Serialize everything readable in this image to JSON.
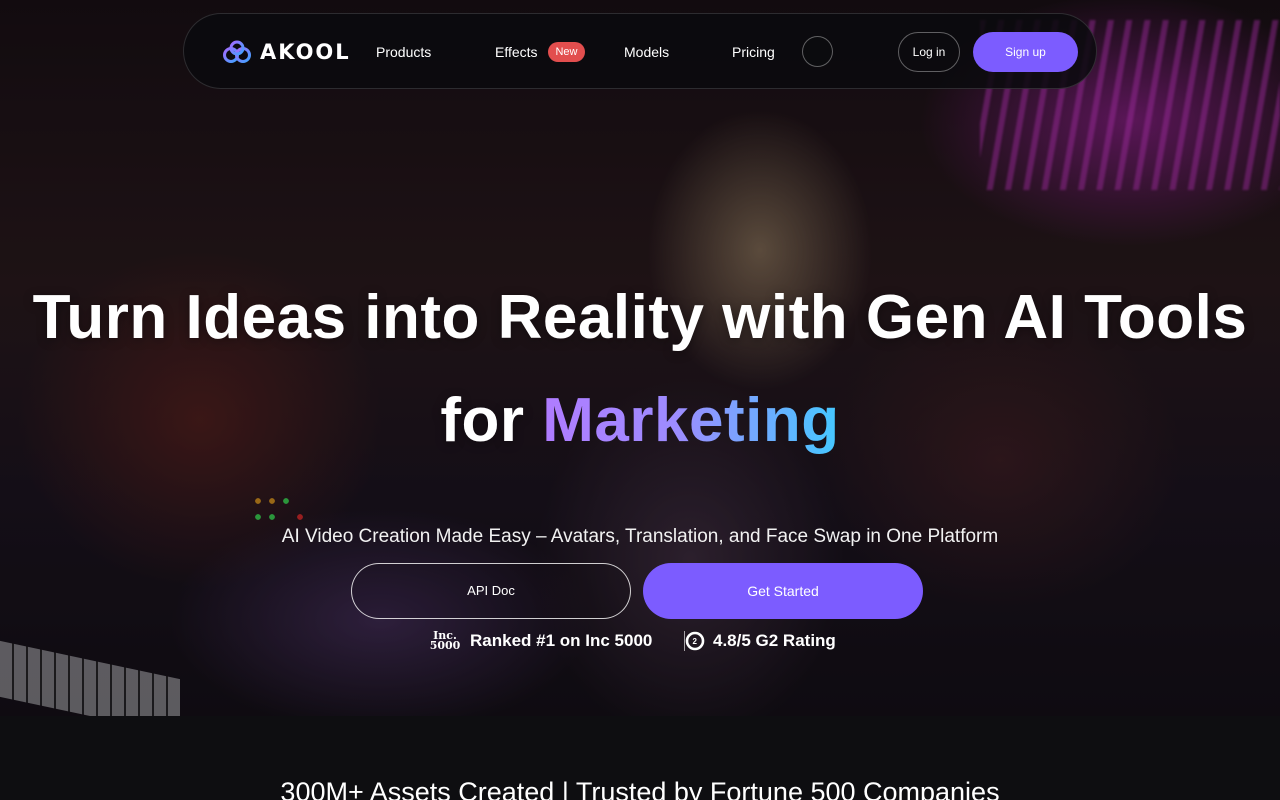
{
  "brand": {
    "name": "AKOOL"
  },
  "nav": {
    "items": [
      {
        "label": "Products"
      },
      {
        "label": "Effects"
      },
      {
        "label": "Models"
      },
      {
        "label": "Pricing"
      }
    ],
    "new_badge": "New",
    "login_label": "Log in",
    "signup_label": "Sign up"
  },
  "hero": {
    "headline_line1": "Turn Ideas into Reality with Gen AI Tools",
    "headline_line2_prefix": "for",
    "headline_line2_highlight": "Marketing",
    "subtitle": "AI Video Creation Made Easy – Avatars, Translation, and Face Swap in One Platform",
    "api_doc_label": "API Doc",
    "get_started_label": "Get Started",
    "inc_logo_top": "Inc.",
    "inc_logo_bottom": "5000",
    "inc_text": "Ranked #1 on Inc 5000",
    "g2_text": "4.8/5 G2 Rating"
  },
  "trust": {
    "text": "300M+ Assets Created | Trusted by Fortune 500 Companies"
  },
  "colors": {
    "accent": "#7c5cff",
    "badge": "#e24e4e",
    "gradient_start": "#b07cff",
    "gradient_end": "#44c8ff"
  },
  "icons": [
    "akool-logo-icon",
    "inc-5000-logo",
    "g2-icon"
  ]
}
